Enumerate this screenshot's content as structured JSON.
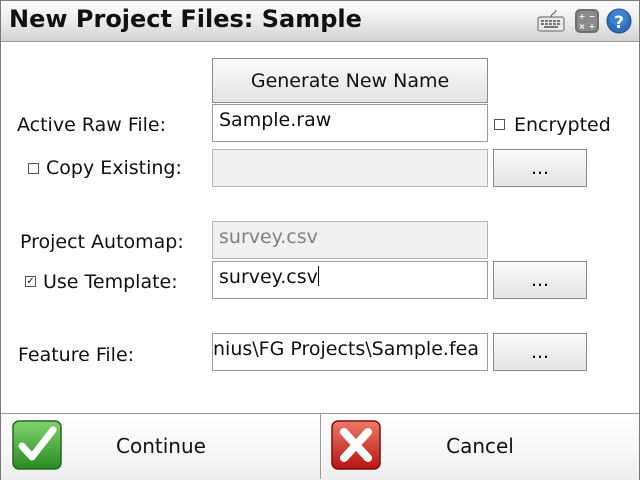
{
  "window": {
    "title": "New Project Files: Sample",
    "icons": [
      "keyboard-icon",
      "calculator-icon",
      "help-icon"
    ]
  },
  "buttons": {
    "generate_new_name": "Generate New Name",
    "browse": "...",
    "continue": "Continue",
    "cancel": "Cancel"
  },
  "active_raw_file": {
    "label": "Active Raw File:",
    "value": "Sample.raw",
    "encrypted_label": "Encrypted",
    "encrypted_checked": false
  },
  "copy_existing": {
    "label": "Copy Existing:",
    "checked": false,
    "value": ""
  },
  "project_automap": {
    "label": "Project Automap:",
    "value": "survey.csv"
  },
  "use_template": {
    "label": "Use Template:",
    "checked": true,
    "value": "survey.csv"
  },
  "feature_file": {
    "label": "Feature File:",
    "value": "nius\\FG Projects\\Sample.fea"
  },
  "colors": {
    "check_green": "#2e9a2e",
    "cancel_red": "#c8201c",
    "help_blue": "#2a6fc0"
  }
}
